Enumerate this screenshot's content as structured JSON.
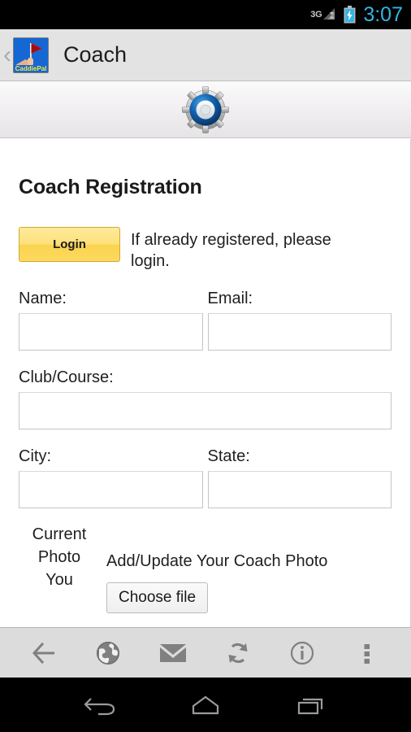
{
  "statusbar": {
    "network_label": "3G",
    "signal_icon": "signal-bars-icon",
    "battery_icon": "battery-charging-icon",
    "clock": "3:07",
    "accent_color": "#33b5e5"
  },
  "appbar": {
    "back_icon": "back-chevron-icon",
    "app_icon": "caddiepal-app-icon",
    "app_icon_label": "CaddiePal",
    "title": "Coach"
  },
  "gearband": {
    "icon": "gear-icon"
  },
  "page": {
    "title": "Coach Registration",
    "login_button": "Login",
    "login_note": "If already registered, please login.",
    "fields": {
      "name_label": "Name:",
      "name_value": "",
      "email_label": "Email:",
      "email_value": "",
      "club_label": "Club/Course:",
      "club_value": "",
      "city_label": "City:",
      "city_value": "",
      "state_label": "State:",
      "state_value": ""
    },
    "photo": {
      "current_photo_label": "Current Photo",
      "you_label": "You",
      "heading": "Add/Update Your Coach Photo",
      "choose_file_button": "Choose file"
    }
  },
  "toolbar": {
    "items": [
      {
        "name": "back-arrow-icon"
      },
      {
        "name": "globe-icon"
      },
      {
        "name": "envelope-icon"
      },
      {
        "name": "refresh-icon"
      },
      {
        "name": "info-icon"
      },
      {
        "name": "overflow-menu-icon"
      }
    ]
  },
  "navbar": {
    "items": [
      {
        "name": "android-back-icon"
      },
      {
        "name": "android-home-icon"
      },
      {
        "name": "android-recents-icon"
      }
    ]
  }
}
